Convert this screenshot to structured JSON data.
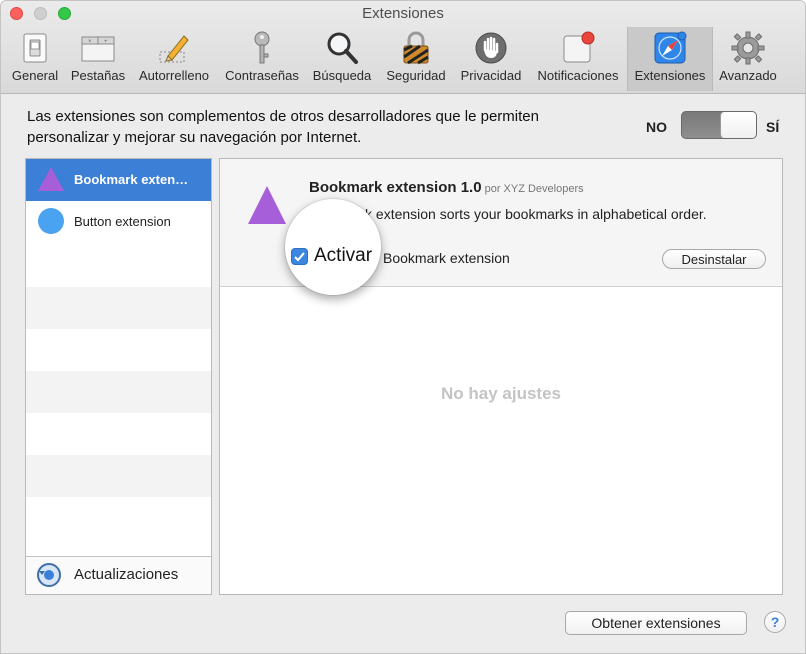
{
  "window": {
    "title": "Extensiones"
  },
  "toolbar": {
    "items": [
      {
        "label": "General",
        "icon": "switch-icon"
      },
      {
        "label": "Pestañas",
        "icon": "tabs-icon"
      },
      {
        "label": "Autorrelleno",
        "icon": "pencil-icon"
      },
      {
        "label": "Contraseñas",
        "icon": "key-icon"
      },
      {
        "label": "Búsqueda",
        "icon": "magnifier-icon"
      },
      {
        "label": "Seguridad",
        "icon": "padlock-icon"
      },
      {
        "label": "Privacidad",
        "icon": "hand-icon"
      },
      {
        "label": "Notificaciones",
        "icon": "notification-icon"
      },
      {
        "label": "Extensiones",
        "icon": "extensions-compass-icon",
        "selected": true
      },
      {
        "label": "Avanzado",
        "icon": "gear-icon"
      }
    ]
  },
  "description": "Las extensiones son complementos de otros desarrolladores que le permiten personalizar y mejorar su navegación por Internet.",
  "toggle": {
    "off_label": "NO",
    "on_label": "SÍ",
    "state": "on"
  },
  "extensions_list": {
    "items": [
      {
        "label": "Bookmark exten…",
        "icon": "purple-triangle-icon",
        "selected": true
      },
      {
        "label": "Button extension",
        "icon": "blue-circle-icon",
        "selected": false
      }
    ],
    "updates_label": "Actualizaciones"
  },
  "detail": {
    "name": "Bookmark extension 1.0",
    "author": "por XYZ Developers",
    "description": "Bookmark extension sorts your bookmarks in alphabetical order.",
    "activate_label": "Activar",
    "activate_suffix": "Bookmark extension",
    "activate_checked": true,
    "uninstall_label": "Desinstalar",
    "empty_settings": "No hay ajustes"
  },
  "footer": {
    "get_extensions_label": "Obtener extensiones",
    "help_label": "?"
  },
  "colors": {
    "selection": "#3b7fd6",
    "triangle": "#a65fd8",
    "circle": "#4aa3f0",
    "notification_dot": "#e8453c"
  }
}
